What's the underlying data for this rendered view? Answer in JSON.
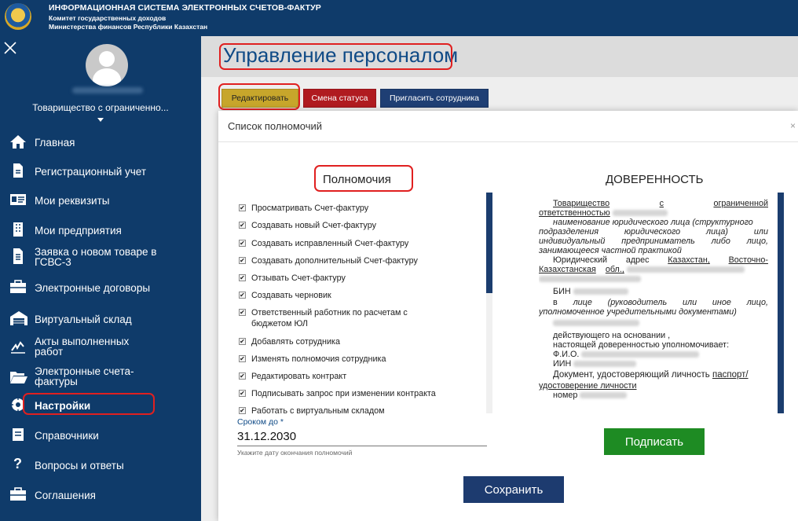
{
  "header": {
    "line1": "ИНФОРМАЦИОННАЯ СИСТЕМА ЭЛЕКТРОННЫХ СЧЕТОВ-ФАКТУР",
    "line2": "Комитет государственных доходов",
    "line3": "Министерства финансов Республики Казахстан"
  },
  "sidebar": {
    "close_icon": "close-icon",
    "organization": "Товарищество с ограниченно...",
    "items": [
      {
        "label": "Главная",
        "icon": "home-icon"
      },
      {
        "label": "Регистрационный учет",
        "icon": "document-icon"
      },
      {
        "label": "Мои реквизиты",
        "icon": "id-card-icon"
      },
      {
        "label": "Мои предприятия",
        "icon": "building-icon"
      },
      {
        "label": "Заявка о новом товаре в ГСВС-3",
        "icon": "file-text-icon"
      },
      {
        "label": "Электронные договоры",
        "icon": "briefcase-icon"
      },
      {
        "label": "Виртуальный склад",
        "icon": "warehouse-icon"
      },
      {
        "label": "Акты выполненных работ",
        "icon": "signature-icon"
      },
      {
        "label": "Электронные счета-фактуры",
        "icon": "folder-open-icon"
      },
      {
        "label": "Настройки",
        "icon": "settings-icon"
      },
      {
        "label": "Справочники",
        "icon": "book-icon"
      },
      {
        "label": "Вопросы и ответы",
        "icon": "question-icon"
      },
      {
        "label": "Соглашения",
        "icon": "handshake-icon"
      }
    ]
  },
  "page": {
    "title": "Управление персоналом",
    "actions": {
      "edit": "Редактировать",
      "change_status": "Смена статуса",
      "invite": "Пригласить сотрудника"
    }
  },
  "modal": {
    "title": "Список полномочий",
    "close": "×",
    "permissions_title": "Полномочия",
    "permissions": [
      "Просматривать Счет-фактуру",
      "Создавать новый Счет-фактуру",
      "Создавать исправленный Счет-фактуру",
      "Создавать дополнительный Счет-фактуру",
      "Отзывать Счет-фактуру",
      "Создавать черновик",
      "Ответственный работник по расчетам с бюджетом ЮЛ",
      "Добавлять сотрудника",
      "Изменять полномочия сотрудника",
      "Редактировать контракт",
      "Подписывать запрос при изменении контракта",
      "Работать с виртуальным складом"
    ],
    "checkbox_mark": "✔",
    "doc_title": "ДОВЕРЕННОСТЬ",
    "doc": {
      "l1a": "Товарищество",
      "l1b": "с",
      "l1c": "ограниченной",
      "l2": "ответственностью",
      "l3": "наименование юридического лица (структурного",
      "l4a": "подразделения",
      "l4b": "юридического",
      "l4c": "лица)",
      "l4d": "или",
      "l5a": "индивидуальный",
      "l5b": "предприниматель",
      "l5c": "либо",
      "l5d": "лицо,",
      "l6": "занимающееся частной практикой",
      "l7a": "Юридический",
      "l7b": "адрес",
      "l7c": "Казахстан,",
      "l7d": "Восточно-",
      "l8a": "Казахстанская",
      "l8b": "обл.,",
      "l9": "БИН",
      "l10a": "в",
      "l10b": "лице",
      "l10c": "(руководитель",
      "l10d": "или",
      "l10e": "иное",
      "l10f": "лицо,",
      "l11": "уполномоченное учредительными документами)",
      "l12": "действующего на основании ,",
      "l13": "настоящей доверенностью уполномочивает:",
      "l14": "Ф.И.О.",
      "l15": "ИИН",
      "l16a": "Документ, удостоверяющий личность",
      "l16b": "паспорт/",
      "l17": "удостоверение личности",
      "l18": "номер"
    },
    "valid_until_label": "Сроком до *",
    "valid_until_value": "31.12.2030",
    "valid_until_hint": "Укажите дату окончания полномочий",
    "sign_button": "Подписать",
    "save_button": "Сохранить"
  },
  "colors": {
    "sidebar_bg": "#0f3b6a",
    "edit_button": "#c7a62b",
    "status_button": "#b01b20",
    "invite_button": "#1f3f74",
    "sign_button": "#1e8b23",
    "save_button": "#1d3b6f",
    "highlight": "#e02020"
  }
}
